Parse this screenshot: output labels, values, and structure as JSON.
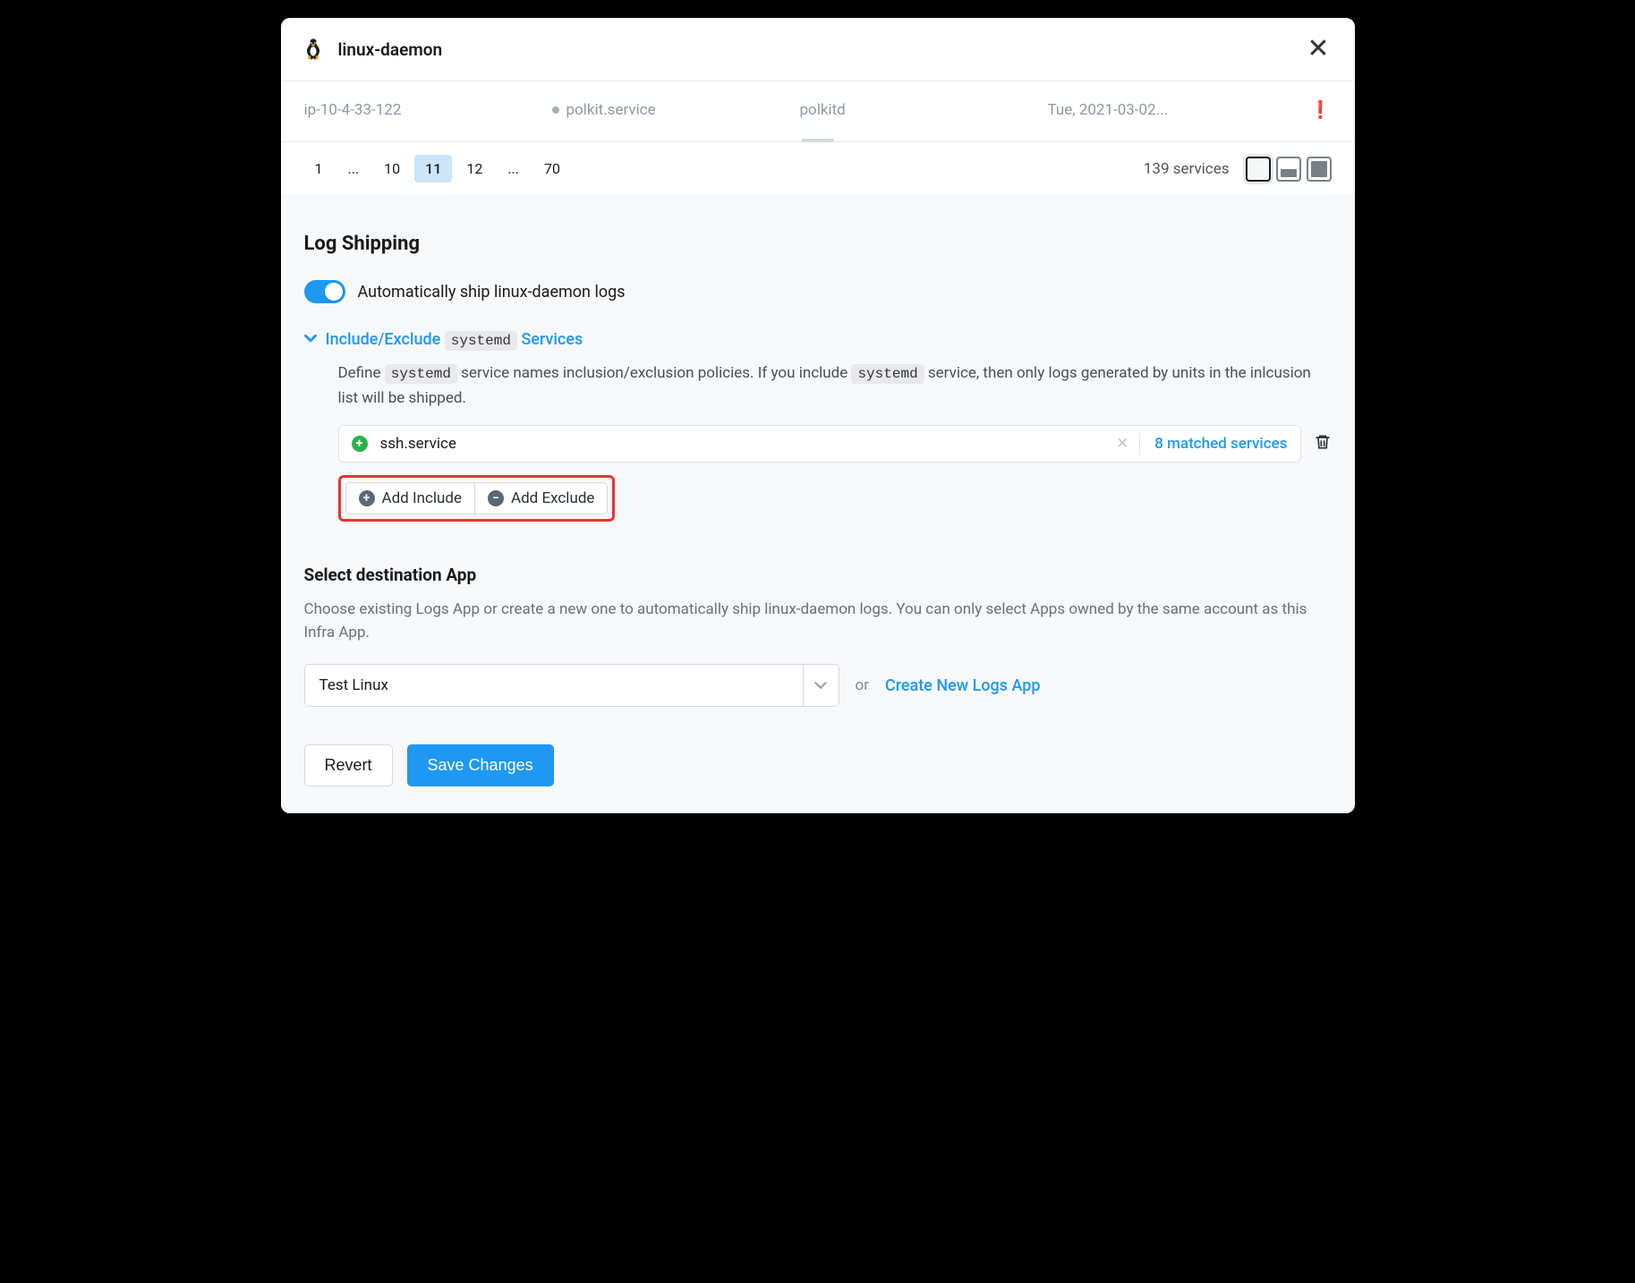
{
  "header": {
    "title": "linux-daemon"
  },
  "info": {
    "host": "ip-10-4-33-122",
    "service": "polkit.service",
    "process": "polkitd",
    "date": "Tue, 2021-03-02..."
  },
  "pagination": {
    "pages": [
      "1",
      "...",
      "10",
      "11",
      "12",
      "...",
      "70"
    ],
    "active": "11",
    "count": "139 services"
  },
  "log_shipping": {
    "title": "Log Shipping",
    "toggle_label": "Automatically ship linux-daemon logs",
    "collapse_prefix": "Include/Exclude",
    "systemd_chip": "systemd",
    "collapse_suffix": "Services",
    "desc_p1": "Define ",
    "desc_p2": " service names inclusion/exclusion policies. If you include ",
    "desc_p3": " service, then only logs generated by units in the inlcusion list will be shipped.",
    "filter_value": "ssh.service",
    "matched": "8 matched services",
    "add_include": "Add Include",
    "add_exclude": "Add Exclude"
  },
  "destination": {
    "title": "Select destination App",
    "desc": "Choose existing Logs App or create a new one to automatically ship linux-daemon logs. You can only select Apps owned by the same account as this Infra App.",
    "selected": "Test Linux",
    "or": "or",
    "create": "Create New Logs App"
  },
  "actions": {
    "revert": "Revert",
    "save": "Save Changes"
  }
}
